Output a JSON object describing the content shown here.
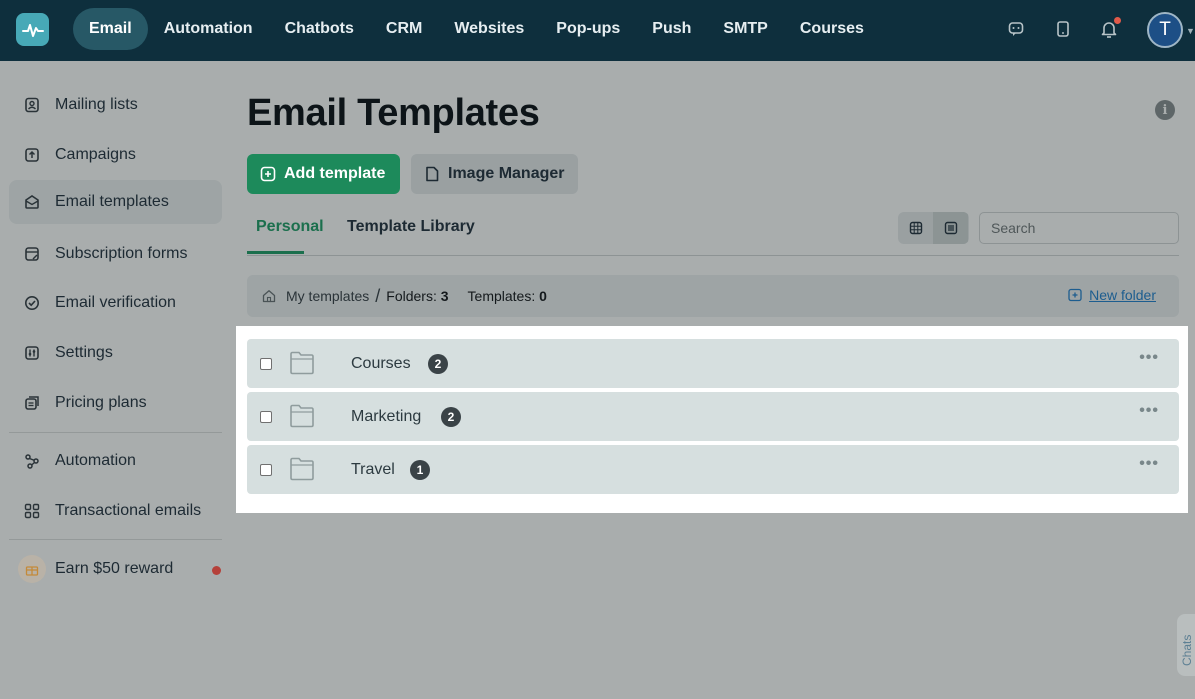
{
  "nav": {
    "items": [
      "Email",
      "Automation",
      "Chatbots",
      "CRM",
      "Websites",
      "Pop-ups",
      "Push",
      "SMTP",
      "Courses"
    ],
    "active": "Email",
    "avatar_letter": "T"
  },
  "sidebar": {
    "items": [
      {
        "label": "Mailing lists",
        "icon": "contacts-icon"
      },
      {
        "label": "Campaigns",
        "icon": "campaign-icon"
      },
      {
        "label": "Email templates",
        "icon": "template-icon"
      },
      {
        "label": "Subscription forms",
        "icon": "form-icon"
      },
      {
        "label": "Email verification",
        "icon": "verify-icon"
      },
      {
        "label": "Settings",
        "icon": "settings-icon"
      },
      {
        "label": "Pricing plans",
        "icon": "pricing-icon"
      },
      {
        "label": "Automation",
        "icon": "automation-icon"
      },
      {
        "label": "Transactional emails",
        "icon": "grid-icon"
      },
      {
        "label": "Earn $50 reward",
        "icon": "gift-icon"
      }
    ]
  },
  "main": {
    "title": "Email Templates",
    "add_template": "Add template",
    "image_manager": "Image Manager",
    "tabs": [
      "Personal",
      "Template Library"
    ],
    "search_placeholder": "Search",
    "breadcrumb": {
      "root": "My templates",
      "folders_label": "Folders:",
      "folders_count": "3",
      "templates_label": "Templates:",
      "templates_count": "0",
      "new_folder": "New folder"
    },
    "folders": [
      {
        "name": "Courses",
        "count": "2"
      },
      {
        "name": "Marketing",
        "count": "2"
      },
      {
        "name": "Travel",
        "count": "1"
      }
    ]
  },
  "chats_tab": "Chats",
  "colors": {
    "accent_green": "#1d8a5b",
    "nav_bg": "#0e2f3d",
    "link_blue": "#1d5d8f"
  }
}
